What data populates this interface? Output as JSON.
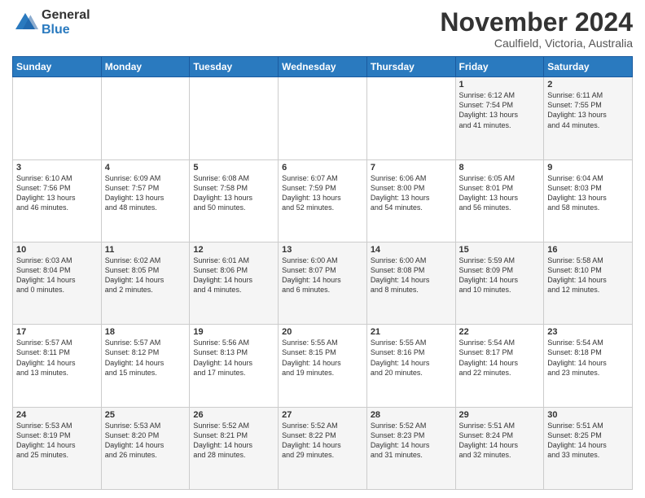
{
  "logo": {
    "general": "General",
    "blue": "Blue"
  },
  "header": {
    "month_title": "November 2024",
    "location": "Caulfield, Victoria, Australia"
  },
  "days_of_week": [
    "Sunday",
    "Monday",
    "Tuesday",
    "Wednesday",
    "Thursday",
    "Friday",
    "Saturday"
  ],
  "weeks": [
    [
      {
        "day": "",
        "info": ""
      },
      {
        "day": "",
        "info": ""
      },
      {
        "day": "",
        "info": ""
      },
      {
        "day": "",
        "info": ""
      },
      {
        "day": "",
        "info": ""
      },
      {
        "day": "1",
        "info": "Sunrise: 6:12 AM\nSunset: 7:54 PM\nDaylight: 13 hours\nand 41 minutes."
      },
      {
        "day": "2",
        "info": "Sunrise: 6:11 AM\nSunset: 7:55 PM\nDaylight: 13 hours\nand 44 minutes."
      }
    ],
    [
      {
        "day": "3",
        "info": "Sunrise: 6:10 AM\nSunset: 7:56 PM\nDaylight: 13 hours\nand 46 minutes."
      },
      {
        "day": "4",
        "info": "Sunrise: 6:09 AM\nSunset: 7:57 PM\nDaylight: 13 hours\nand 48 minutes."
      },
      {
        "day": "5",
        "info": "Sunrise: 6:08 AM\nSunset: 7:58 PM\nDaylight: 13 hours\nand 50 minutes."
      },
      {
        "day": "6",
        "info": "Sunrise: 6:07 AM\nSunset: 7:59 PM\nDaylight: 13 hours\nand 52 minutes."
      },
      {
        "day": "7",
        "info": "Sunrise: 6:06 AM\nSunset: 8:00 PM\nDaylight: 13 hours\nand 54 minutes."
      },
      {
        "day": "8",
        "info": "Sunrise: 6:05 AM\nSunset: 8:01 PM\nDaylight: 13 hours\nand 56 minutes."
      },
      {
        "day": "9",
        "info": "Sunrise: 6:04 AM\nSunset: 8:03 PM\nDaylight: 13 hours\nand 58 minutes."
      }
    ],
    [
      {
        "day": "10",
        "info": "Sunrise: 6:03 AM\nSunset: 8:04 PM\nDaylight: 14 hours\nand 0 minutes."
      },
      {
        "day": "11",
        "info": "Sunrise: 6:02 AM\nSunset: 8:05 PM\nDaylight: 14 hours\nand 2 minutes."
      },
      {
        "day": "12",
        "info": "Sunrise: 6:01 AM\nSunset: 8:06 PM\nDaylight: 14 hours\nand 4 minutes."
      },
      {
        "day": "13",
        "info": "Sunrise: 6:00 AM\nSunset: 8:07 PM\nDaylight: 14 hours\nand 6 minutes."
      },
      {
        "day": "14",
        "info": "Sunrise: 6:00 AM\nSunset: 8:08 PM\nDaylight: 14 hours\nand 8 minutes."
      },
      {
        "day": "15",
        "info": "Sunrise: 5:59 AM\nSunset: 8:09 PM\nDaylight: 14 hours\nand 10 minutes."
      },
      {
        "day": "16",
        "info": "Sunrise: 5:58 AM\nSunset: 8:10 PM\nDaylight: 14 hours\nand 12 minutes."
      }
    ],
    [
      {
        "day": "17",
        "info": "Sunrise: 5:57 AM\nSunset: 8:11 PM\nDaylight: 14 hours\nand 13 minutes."
      },
      {
        "day": "18",
        "info": "Sunrise: 5:57 AM\nSunset: 8:12 PM\nDaylight: 14 hours\nand 15 minutes."
      },
      {
        "day": "19",
        "info": "Sunrise: 5:56 AM\nSunset: 8:13 PM\nDaylight: 14 hours\nand 17 minutes."
      },
      {
        "day": "20",
        "info": "Sunrise: 5:55 AM\nSunset: 8:15 PM\nDaylight: 14 hours\nand 19 minutes."
      },
      {
        "day": "21",
        "info": "Sunrise: 5:55 AM\nSunset: 8:16 PM\nDaylight: 14 hours\nand 20 minutes."
      },
      {
        "day": "22",
        "info": "Sunrise: 5:54 AM\nSunset: 8:17 PM\nDaylight: 14 hours\nand 22 minutes."
      },
      {
        "day": "23",
        "info": "Sunrise: 5:54 AM\nSunset: 8:18 PM\nDaylight: 14 hours\nand 23 minutes."
      }
    ],
    [
      {
        "day": "24",
        "info": "Sunrise: 5:53 AM\nSunset: 8:19 PM\nDaylight: 14 hours\nand 25 minutes."
      },
      {
        "day": "25",
        "info": "Sunrise: 5:53 AM\nSunset: 8:20 PM\nDaylight: 14 hours\nand 26 minutes."
      },
      {
        "day": "26",
        "info": "Sunrise: 5:52 AM\nSunset: 8:21 PM\nDaylight: 14 hours\nand 28 minutes."
      },
      {
        "day": "27",
        "info": "Sunrise: 5:52 AM\nSunset: 8:22 PM\nDaylight: 14 hours\nand 29 minutes."
      },
      {
        "day": "28",
        "info": "Sunrise: 5:52 AM\nSunset: 8:23 PM\nDaylight: 14 hours\nand 31 minutes."
      },
      {
        "day": "29",
        "info": "Sunrise: 5:51 AM\nSunset: 8:24 PM\nDaylight: 14 hours\nand 32 minutes."
      },
      {
        "day": "30",
        "info": "Sunrise: 5:51 AM\nSunset: 8:25 PM\nDaylight: 14 hours\nand 33 minutes."
      }
    ]
  ]
}
